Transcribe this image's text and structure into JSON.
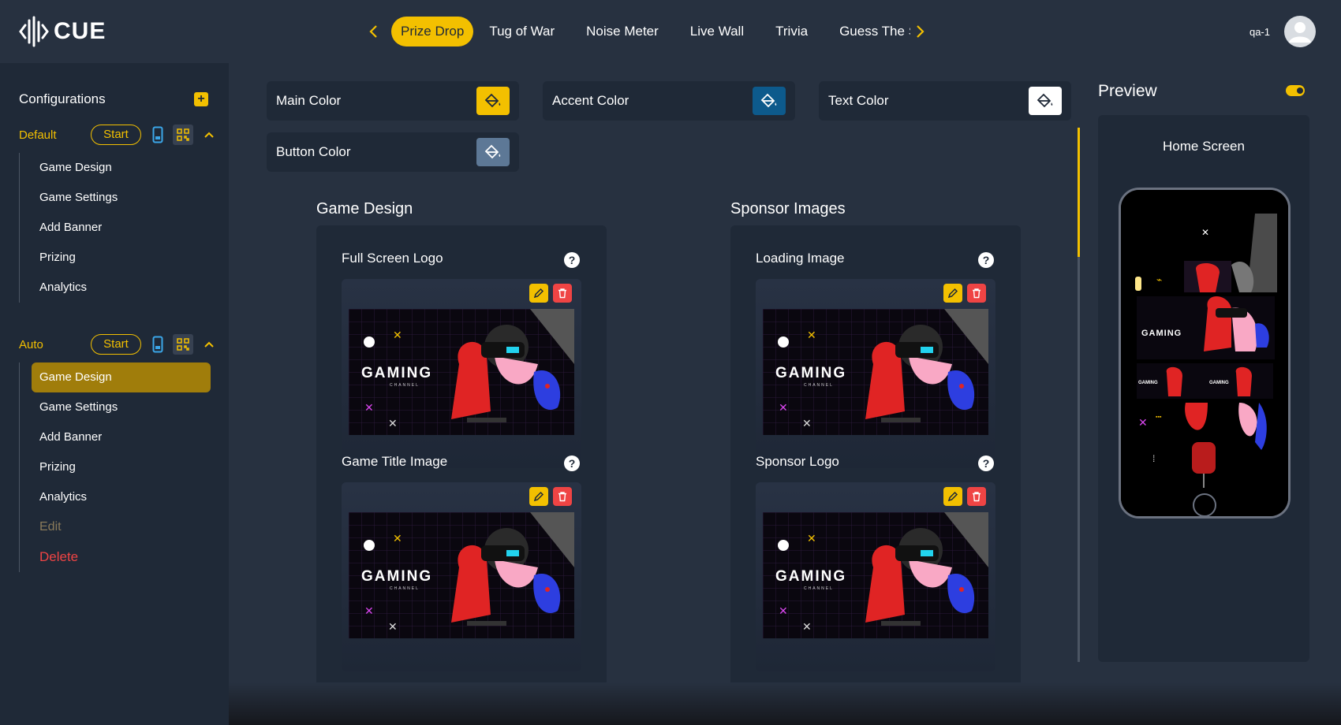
{
  "app": {
    "name": "CUE"
  },
  "nav": {
    "tabs": [
      {
        "label": "Prize Drop"
      },
      {
        "label": "Tug of War"
      },
      {
        "label": "Noise Meter"
      },
      {
        "label": "Live Wall"
      },
      {
        "label": "Trivia"
      },
      {
        "label": "Guess The Sc"
      }
    ],
    "active_tab": "Prize Drop"
  },
  "user": {
    "name": "qa-1",
    "icon": "user-avatar-icon"
  },
  "sidebar": {
    "title": "Configurations",
    "configs": [
      {
        "name": "Default",
        "start_label": "Start",
        "items": [
          "Game Design",
          "Game Settings",
          "Add Banner",
          "Prizing",
          "Analytics"
        ]
      },
      {
        "name": "Auto",
        "start_label": "Start",
        "items": [
          "Game Design",
          "Game Settings",
          "Add Banner",
          "Prizing",
          "Analytics"
        ],
        "active_item": "Game Design",
        "edit_label": "Edit",
        "delete_label": "Delete"
      }
    ]
  },
  "colors": {
    "main": {
      "label": "Main Color",
      "value": "#f3c000"
    },
    "accent": {
      "label": "Accent Color",
      "value": "#0d5a8c"
    },
    "text": {
      "label": "Text Color",
      "value": "#ffffff"
    },
    "button": {
      "label": "Button Color",
      "value": "#5d7896"
    }
  },
  "game_design": {
    "title": "Game Design",
    "images": [
      {
        "label": "Full Screen Logo"
      },
      {
        "label": "Game Title Image"
      }
    ]
  },
  "sponsor_images": {
    "title": "Sponsor Images",
    "images": [
      {
        "label": "Loading Image"
      },
      {
        "label": "Sponsor Logo"
      }
    ]
  },
  "thumbnail": {
    "headline": "GAMING",
    "subline": "CHANNEL"
  },
  "preview": {
    "title": "Preview",
    "subtitle": "Home Screen",
    "toggle_on": true
  },
  "theme": {
    "accent": "#f3c000",
    "danger": "#ef4444",
    "background": "#273140",
    "panel": "#1f2937"
  }
}
